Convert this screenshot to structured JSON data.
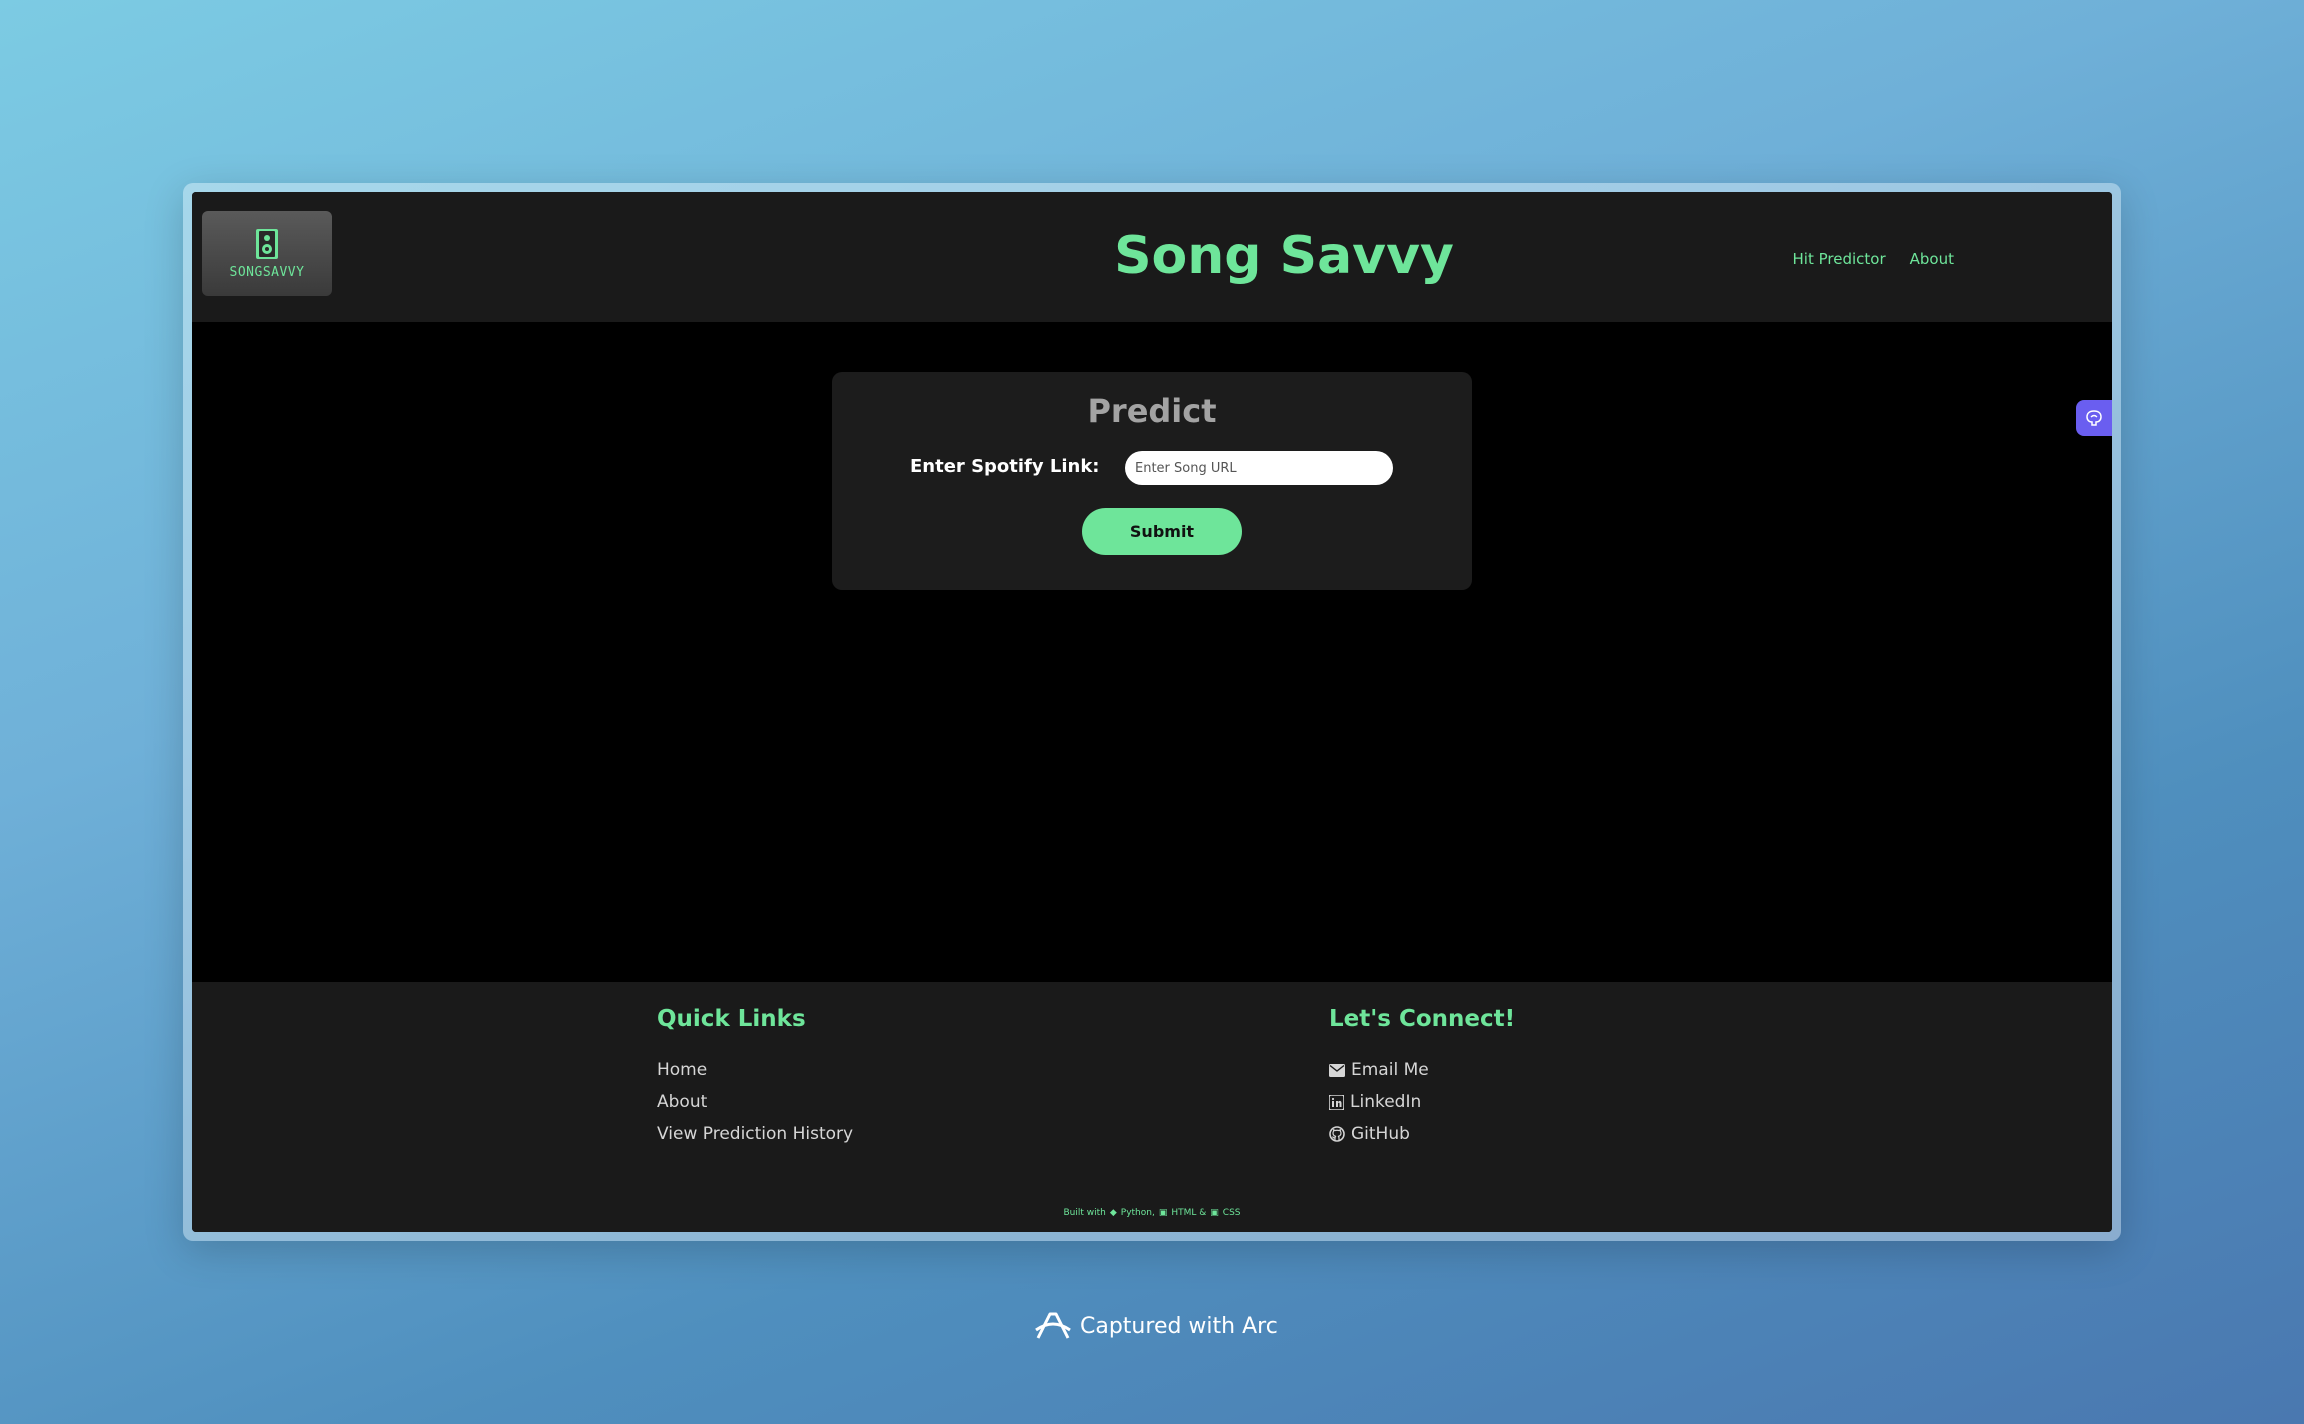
{
  "header": {
    "logo_text": "SONGSAVVY",
    "title": "Song Savvy",
    "nav": [
      {
        "label": "Hit Predictor"
      },
      {
        "label": "About"
      }
    ]
  },
  "predict": {
    "title": "Predict",
    "label": "Enter Spotify Link:",
    "placeholder": "Enter Song URL",
    "value": "",
    "submit_label": "Submit"
  },
  "footer": {
    "quick_links_title": "Quick Links",
    "quick_links": [
      {
        "label": "Home"
      },
      {
        "label": "About"
      },
      {
        "label": "View Prediction History"
      }
    ],
    "connect_title": "Let's Connect!",
    "connect_links": [
      {
        "label": "Email Me",
        "icon": "envelope-icon"
      },
      {
        "label": "LinkedIn",
        "icon": "linkedin-icon"
      },
      {
        "label": "GitHub",
        "icon": "github-icon"
      }
    ],
    "built_with": {
      "prefix": "Built with",
      "python": "Python,",
      "html": "HTML &",
      "css": "CSS"
    }
  },
  "capture_credit": "Captured with Arc",
  "colors": {
    "accent": "#6ee59a",
    "header_bg": "#1a1a1a",
    "card_bg": "#1c1c1c",
    "ai_tab": "#6a5ef0"
  }
}
